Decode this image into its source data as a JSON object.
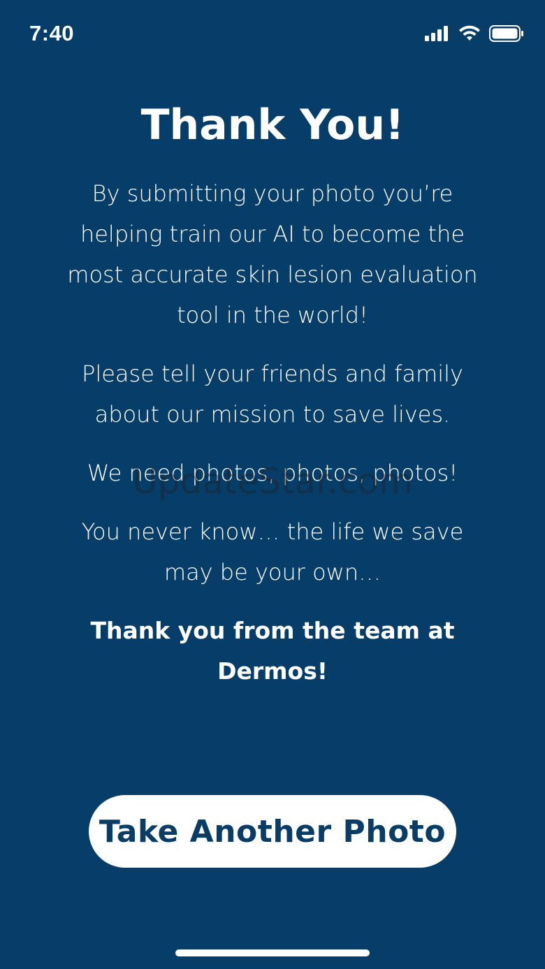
{
  "status_bar": {
    "time": "7:40",
    "icons": [
      "cellular-signal-icon",
      "wifi-icon",
      "battery-icon"
    ]
  },
  "main": {
    "title": "Thank You!",
    "paragraph_1": "By submitting your photo you’re helping train our AI to become the most accurate skin lesion evaluation tool in the world!",
    "paragraph_2": "Please tell your friends and family about our mission to save lives.",
    "paragraph_3": "We need photos, photos, photos!",
    "paragraph_4": "You never know… the life we save may be your own…",
    "sign_off": "Thank you from the team at Dermos!"
  },
  "watermark": "UpdateStar.com",
  "actions": {
    "take_another_photo_label": "Take Another Photo"
  },
  "colors": {
    "background": "#073e69",
    "button_background": "#ffffff",
    "button_text": "#0a3d66"
  }
}
